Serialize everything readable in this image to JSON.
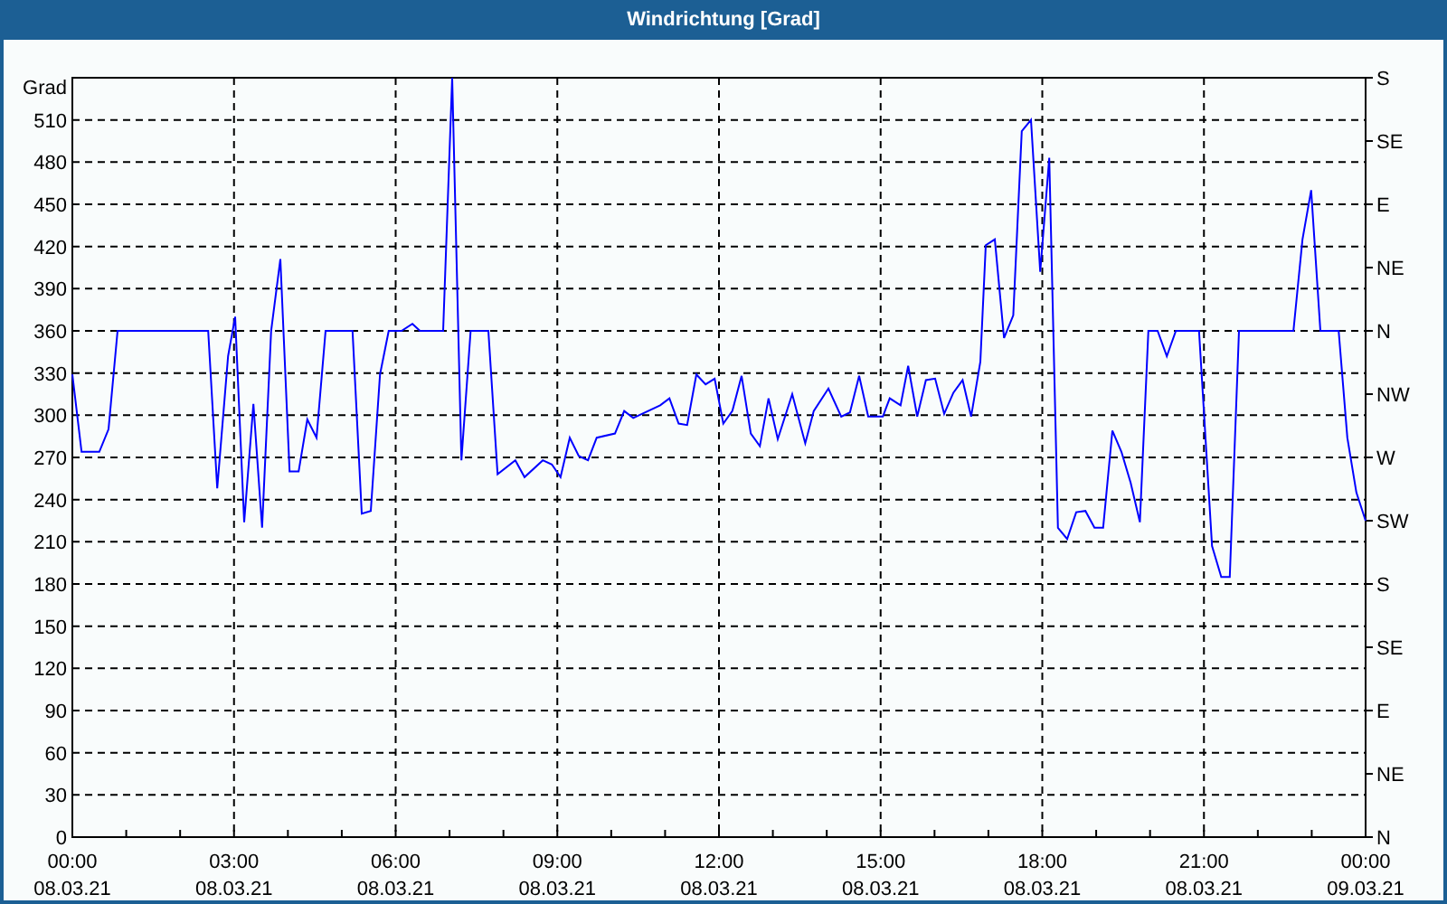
{
  "window": {
    "title": "Windrichtung [Grad]"
  },
  "chart": {
    "x_axis_dates": [
      "08.03.21",
      "08.03.21",
      "08.03.21",
      "08.03.21",
      "08.03.21",
      "08.03.21",
      "08.03.21",
      "08.03.21",
      "09.03.21"
    ],
    "right_axis_labels": [
      "S",
      "SE",
      "E",
      "NE",
      "N",
      "NW",
      "W",
      "SW",
      "S",
      "SE",
      "E",
      "NE",
      "N"
    ],
    "chart_data": {
      "type": "line",
      "grid": true,
      "ylabel": "Grad",
      "xlim": [
        0,
        24
      ],
      "ylim": [
        0,
        540
      ],
      "xticks": [
        {
          "value": 0,
          "label": "00:00"
        },
        {
          "value": 3,
          "label": "03:00"
        },
        {
          "value": 6,
          "label": "06:00"
        },
        {
          "value": 9,
          "label": "09:00"
        },
        {
          "value": 12,
          "label": "12:00"
        },
        {
          "value": 15,
          "label": "15:00"
        },
        {
          "value": 18,
          "label": "18:00"
        },
        {
          "value": 21,
          "label": "21:00"
        },
        {
          "value": 24,
          "label": "00:00"
        }
      ],
      "yticks": [
        0,
        30,
        60,
        90,
        120,
        150,
        180,
        210,
        240,
        270,
        300,
        330,
        360,
        390,
        420,
        450,
        480,
        510
      ],
      "x": [
        0,
        0.17,
        0.5,
        0.67,
        0.84,
        2.52,
        2.69,
        2.89,
        3.02,
        3.19,
        3.36,
        3.52,
        3.69,
        3.86,
        4.03,
        4.2,
        4.36,
        4.53,
        4.7,
        5.2,
        5.37,
        5.54,
        5.71,
        5.87,
        6.11,
        6.31,
        6.45,
        6.88,
        7.05,
        7.22,
        7.39,
        7.72,
        7.89,
        8.22,
        8.39,
        8.73,
        8.9,
        9.06,
        9.23,
        9.4,
        9.57,
        9.73,
        10.07,
        10.24,
        10.41,
        10.91,
        11.08,
        11.25,
        11.41,
        11.58,
        11.75,
        11.92,
        12.08,
        12.25,
        12.42,
        12.59,
        12.76,
        12.92,
        13.09,
        13.36,
        13.6,
        13.76,
        14.03,
        14.27,
        14.43,
        14.6,
        14.77,
        15.04,
        15.17,
        15.37,
        15.51,
        15.68,
        15.84,
        16.01,
        16.18,
        16.35,
        16.52,
        16.68,
        16.85,
        16.95,
        17.12,
        17.29,
        17.46,
        17.62,
        17.79,
        17.96,
        18.13,
        18.29,
        18.46,
        18.63,
        18.8,
        18.97,
        19.13,
        19.3,
        19.47,
        19.64,
        19.81,
        19.97,
        20.14,
        20.31,
        20.48,
        20.91,
        21.15,
        21.32,
        21.48,
        21.65,
        22.66,
        22.83,
        22.99,
        23.16,
        23.5,
        23.66,
        23.83,
        24
      ],
      "series": [
        {
          "color": "#0000ff",
          "values": [
            329,
            274,
            274,
            290,
            360,
            360,
            248,
            342,
            370,
            224,
            308,
            220,
            360,
            411,
            260,
            260,
            297,
            284,
            360,
            360,
            230,
            232,
            329,
            360,
            360,
            365,
            360,
            360,
            540,
            268,
            360,
            360,
            258,
            268,
            256,
            268,
            265,
            256,
            284,
            271,
            268,
            284,
            287,
            303,
            298,
            307,
            312,
            294,
            293,
            329,
            322,
            326,
            294,
            303,
            328,
            287,
            278,
            312,
            283,
            315,
            280,
            303,
            319,
            299,
            302,
            328,
            299,
            299,
            312,
            307,
            335,
            299,
            325,
            326,
            301,
            316,
            325,
            299,
            338,
            421,
            425,
            355,
            371,
            502,
            510,
            402,
            483,
            220,
            212,
            231,
            232,
            220,
            220,
            289,
            274,
            252,
            224,
            360,
            360,
            342,
            360,
            360,
            207,
            185,
            185,
            360,
            360,
            425,
            460,
            360,
            360,
            284,
            245,
            225
          ]
        }
      ]
    }
  }
}
